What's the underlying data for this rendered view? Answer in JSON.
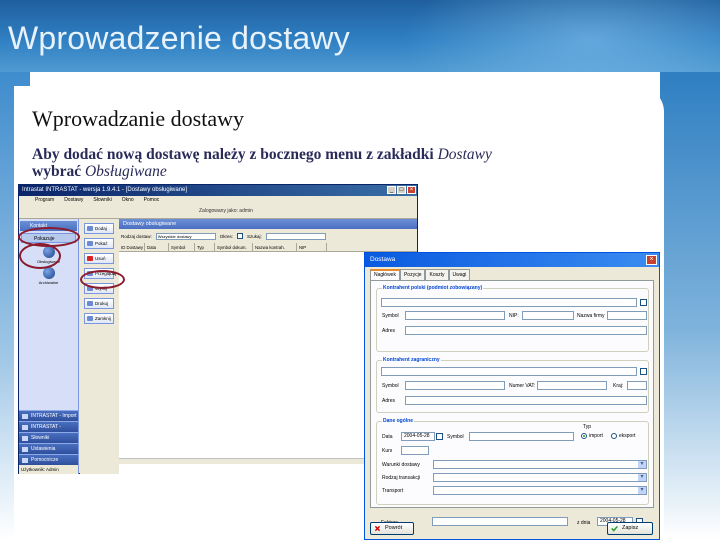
{
  "slide": {
    "title": "Wprowadzenie dostawy",
    "subheading": "Wprowadzanie dostawy",
    "instruction": {
      "line1_prefix": "Aby dodać nową dostawę należy z bocznego menu z zakładki ",
      "line1_em": "Dostawy",
      "line2_prefix": "wybrać ",
      "line2_em": "Obsługiwane"
    }
  },
  "app": {
    "title": "Intrastat INTRASTAT - wersja 1.9.4.1 - [Dostawy obsługiwane]",
    "menu": [
      "Program",
      "Dostawy",
      "Słowniki",
      "Okno",
      "Pomoc"
    ],
    "user": "Zalogowany jako: admin",
    "sidebar": {
      "header": "Kontakt",
      "button": "Pokazuje",
      "icon_caption": "Obsługiwane",
      "icon_caption2": "Archiwalne",
      "navs": [
        "INTRASTAT - Import",
        "INTRASTAT - Eksport",
        "Słowniki",
        "Ustawienia",
        "Pomocnicze"
      ],
      "footer": "Użytkownik: Admin"
    },
    "tools": [
      "Dodaj",
      "Pokaż",
      "Usuń",
      "Przeglądaj",
      "Wyślij",
      "Drukuj",
      "Zamknij"
    ],
    "panel_title": "Dostawy obsługiwane",
    "filters": {
      "type_label": "Rodzaj dostaw:",
      "type_value": "Wszystkie dostawy",
      "period_label": "Okres:",
      "search_label": "Szukaj:"
    },
    "grid_headers": [
      "ID Dostawy",
      "Data",
      "Symbol",
      "Typ",
      "Symbol dokum.",
      "Nazwa kontrah.",
      "NIP"
    ]
  },
  "dialog": {
    "title": "Dostawa",
    "tabs": [
      "Nagłówek",
      "Pozycje",
      "Koszty",
      "Uwagi"
    ],
    "polish": {
      "legend": "Kontrahent polski (podmiot zobowiązany)",
      "symbol": "Symbol",
      "nip": "NIP:",
      "nip_extra": "Nazwa firmy",
      "address": "Adres"
    },
    "foreign": {
      "legend": "Kontrahent zagraniczny",
      "symbol": "Symbol",
      "vat": "Numer VAT:",
      "country": "Kraj:",
      "address": "Adres"
    },
    "general": {
      "legend": "Dane ogólne",
      "date_label": "Data",
      "date_value": "2004-05-28",
      "symbol_label": "Symbol",
      "type_label": "Typ",
      "import_label": "import",
      "export_label": "eksport",
      "rate_label": "Kurs",
      "conditions_label": "Warunki dostawy",
      "transaction_label": "Rodzaj transakcji",
      "transport_label": "Transport",
      "invoice_label": "Faktura",
      "from_label": "z dnia",
      "from_value": "2004-05-28"
    },
    "buttons": {
      "back": "Powrót",
      "save": "Zapisz"
    }
  }
}
